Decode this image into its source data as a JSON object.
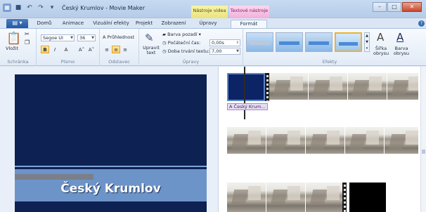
{
  "window": {
    "title": "Český Krumlov - Movie Maker",
    "context_video": "Nástroje videa",
    "context_text": "Textové nástroje",
    "controls": [
      "–",
      "□",
      "✕"
    ]
  },
  "tabs": {
    "file": "▤ ▾",
    "items": [
      "Domů",
      "Animace",
      "Vizuální efekty",
      "Projekt",
      "Zobrazení",
      "Úpravy",
      "Formát"
    ],
    "active_index": 6,
    "help": "?"
  },
  "ribbon": {
    "clipboard": {
      "paste": "Vložit",
      "label": "Schránka"
    },
    "font": {
      "family": "Segoe UI",
      "size": "36",
      "bold": "B",
      "italic": "I",
      "color": "A",
      "grow": "A˄",
      "shrink": "A˅",
      "label": "Písmo"
    },
    "paragraph": {
      "transparency": "Průhlednost",
      "label": "Odstavec"
    },
    "adjust": {
      "edit_text": "Upravit text",
      "bg_color": "Barva pozadí",
      "start_time_label": "Počáteční čas:",
      "start_time_value": "0,00s",
      "duration_label": "Doba trvání textu:",
      "duration_value": "7,00",
      "label": "Úpravy"
    },
    "effects": {
      "outline_size": "Šířka obrysu",
      "outline_color": "Barva obrysu",
      "label": "Efekty"
    }
  },
  "preview": {
    "title_text": "Český Krumlov"
  },
  "storyboard": {
    "caption": "Český Krum..."
  },
  "colors": {
    "accent": "#2457a1",
    "preview_bg": "#0d2152",
    "caption_bg": "#e7dcf4"
  }
}
